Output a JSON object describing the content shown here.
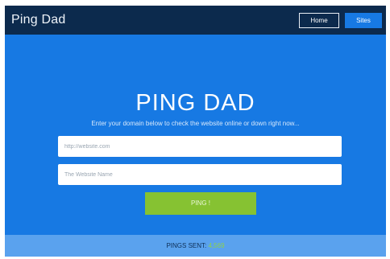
{
  "navbar": {
    "brand": "Ping Dad",
    "home_label": "Home",
    "sites_label": "Sites"
  },
  "hero": {
    "title": "PING DAD",
    "subtitle": "Enter your domain below to check the website online or down right now..."
  },
  "form": {
    "url_placeholder": "http://website.com",
    "name_placeholder": "The Website Name",
    "submit_label": "PING !"
  },
  "footer": {
    "label": "PINGS SENT:",
    "count": "4,569"
  },
  "colors": {
    "navbar_bg": "#0c2a4d",
    "hero_bg": "#1779e3",
    "button_green": "#86c232",
    "footer_bg": "#5aa2ee"
  }
}
